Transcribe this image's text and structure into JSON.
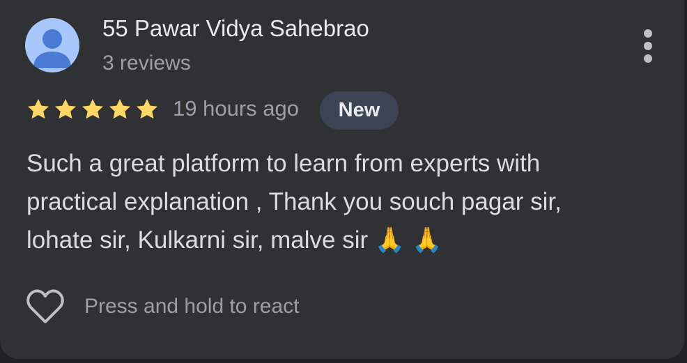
{
  "reviewer": {
    "name": "55 Pawar Vidya Sahebrao",
    "review_count": "3 reviews",
    "avatar_icon": "person-silhouette-icon"
  },
  "menu_icon": "more-vert-icon",
  "rating": {
    "stars": 5,
    "max_stars": 5,
    "star_color": "#fdd663"
  },
  "posted_time": "19 hours ago",
  "badge": "New",
  "review_lines": [
    "Such a great platform to learn from experts with",
    "practical explanation , Thank you souch pagar sir,",
    "lohate sir, Kulkarni sir, malve sir 🙏 🙏"
  ],
  "react": {
    "icon": "heart-outline-icon",
    "label": "Press and hold to react"
  },
  "colors": {
    "card_bg": "#303134",
    "badge_bg": "#3c4454",
    "avatar_bg": "#a8c7fa",
    "avatar_fg": "#4a7bd4"
  }
}
